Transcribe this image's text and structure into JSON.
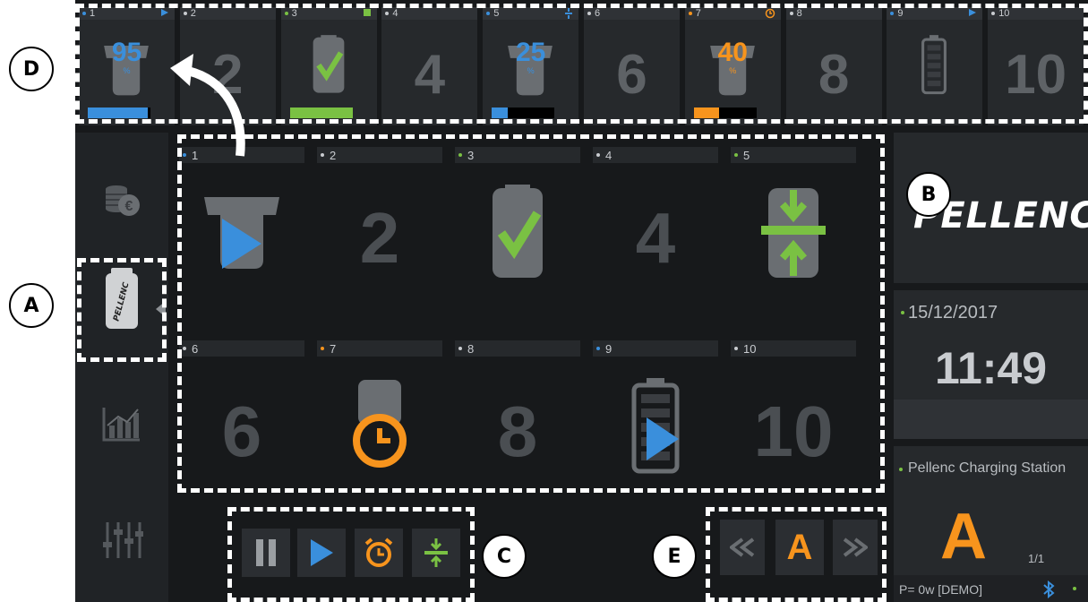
{
  "colors": {
    "background": "#17191b",
    "panel": "#26292c",
    "blue": "#3a8fdc",
    "green": "#7ac143",
    "orange": "#f7941d",
    "grey_number": "#4a4e52"
  },
  "top_strip": [
    {
      "num": "1",
      "dot": "blue",
      "flag": "play-icon",
      "percent": "95",
      "percent_sign": "%",
      "fill": 0.95,
      "fill_color": "blue"
    },
    {
      "num": "2",
      "dot": "white",
      "big": "2"
    },
    {
      "num": "3",
      "dot": "green",
      "flag": "square-icon",
      "icon": "battery-check-icon",
      "fill": 1.0,
      "fill_color": "green"
    },
    {
      "num": "4",
      "dot": "white",
      "big": "4"
    },
    {
      "num": "5",
      "dot": "blue",
      "flag": "compress-icon",
      "percent": "25",
      "percent_sign": "%",
      "fill": 0.25,
      "fill_color": "blue"
    },
    {
      "num": "6",
      "dot": "white",
      "big": "6"
    },
    {
      "num": "7",
      "dot": "orange",
      "flag": "clock-icon",
      "percent": "40",
      "percent_sign": "%",
      "fill": 0.4,
      "fill_color": "orange"
    },
    {
      "num": "8",
      "dot": "white",
      "big": "8"
    },
    {
      "num": "9",
      "dot": "blue",
      "flag": "play-icon",
      "icon": "battery-empty-icon"
    },
    {
      "num": "10",
      "dot": "white",
      "big": "10"
    }
  ],
  "sidebar": [
    {
      "name": "coins-icon"
    },
    {
      "name": "pellenc-battery-icon",
      "label": "PELLENC"
    },
    {
      "name": "bar-chart-icon"
    },
    {
      "name": "sliders-icon"
    }
  ],
  "grid": [
    {
      "num": "1",
      "dot": "blue",
      "icon": "battery-play-icon"
    },
    {
      "num": "2",
      "dot": "white",
      "big": "2"
    },
    {
      "num": "3",
      "dot": "green",
      "icon": "battery-check-icon"
    },
    {
      "num": "4",
      "dot": "white",
      "big": "4"
    },
    {
      "num": "5",
      "dot": "green",
      "icon": "battery-compress-icon"
    },
    {
      "num": "6",
      "dot": "white",
      "big": "6"
    },
    {
      "num": "7",
      "dot": "orange",
      "icon": "battery-alarm-icon"
    },
    {
      "num": "8",
      "dot": "white",
      "big": "8"
    },
    {
      "num": "9",
      "dot": "blue",
      "icon": "battery-charge-play-icon"
    },
    {
      "num": "10",
      "dot": "white",
      "big": "10"
    }
  ],
  "logo": {
    "text": "PELLENC"
  },
  "clock": {
    "date": "15/12/2017",
    "time": "11:49"
  },
  "station": {
    "name": "Pellenc Charging Station",
    "letter": "A",
    "page": "1/1",
    "power": "P= 0w [DEMO]"
  },
  "controls_left": [
    "pause-icon",
    "play-icon",
    "alarm-clock-icon",
    "compress-icon"
  ],
  "controls_right": {
    "prev": "rewind-icon",
    "letter": "A",
    "next": "fast-forward-icon"
  },
  "annotations": {
    "a": "A",
    "b": "B",
    "c": "C",
    "d": "D",
    "e": "E"
  }
}
